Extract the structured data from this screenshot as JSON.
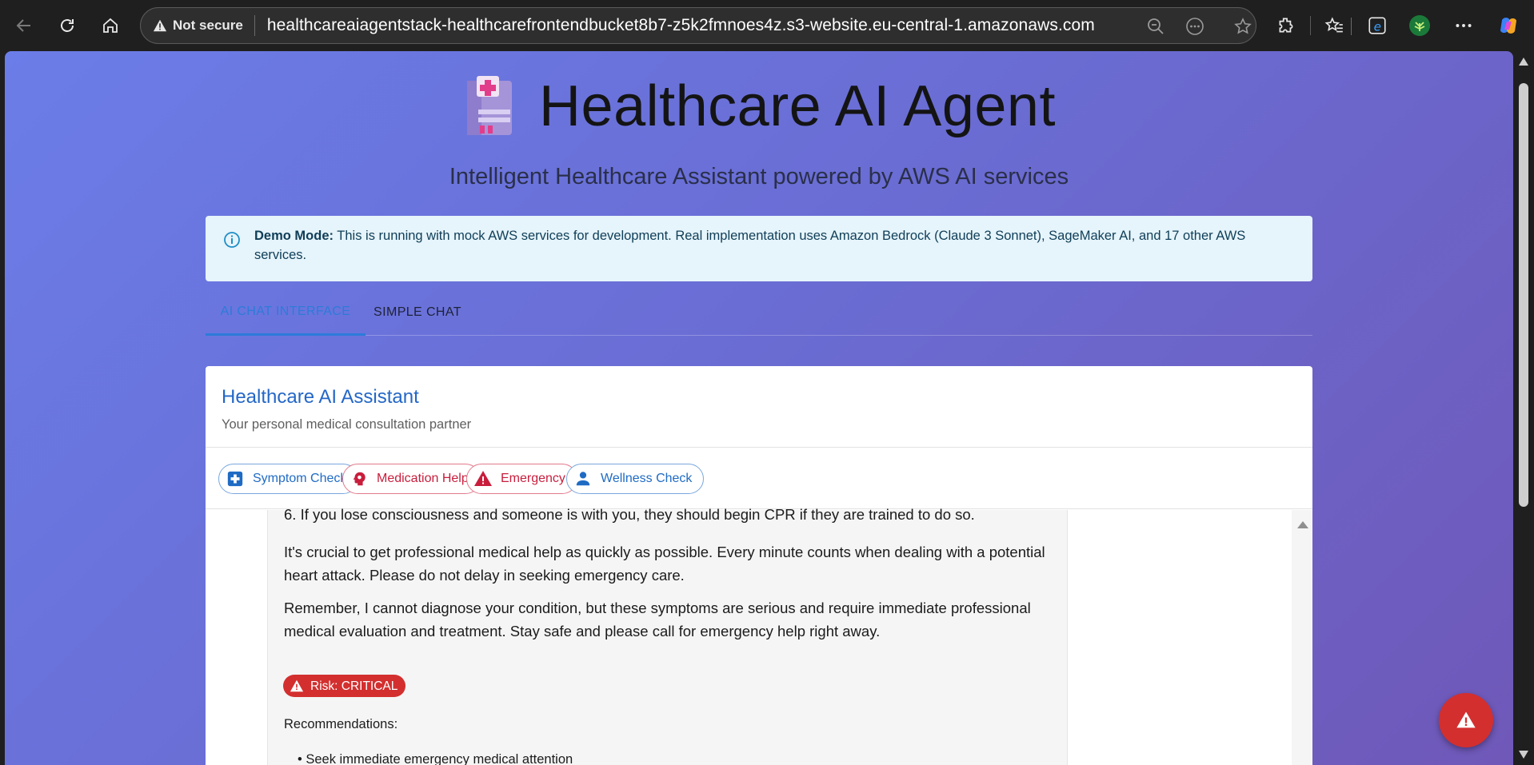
{
  "browser": {
    "security_label": "Not secure",
    "url": "healthcareaiagentstack-healthcarefrontendbucket8b7-z5k2fmnoes4z.s3-website.eu-central-1.amazonaws.com"
  },
  "header": {
    "title": "Healthcare AI Agent",
    "subtitle": "Intelligent Healthcare Assistant powered by AWS AI services"
  },
  "alert": {
    "label": "Demo Mode:",
    "text": " This is running with mock AWS services for development. Real implementation uses Amazon Bedrock (Claude 3 Sonnet), SageMaker AI, and 17 other AWS services."
  },
  "tabs": [
    {
      "label": "AI Chat Interface",
      "active": true
    },
    {
      "label": "Simple Chat",
      "active": false
    }
  ],
  "card": {
    "title": "Healthcare AI Assistant",
    "subtitle": "Your personal medical consultation partner"
  },
  "chips": [
    {
      "label": "Symptom Check",
      "icon": "medical-cross-icon"
    },
    {
      "label": "Medication Help",
      "icon": "psychology-icon"
    },
    {
      "label": "Emergency",
      "icon": "warning-icon"
    },
    {
      "label": "Wellness Check",
      "icon": "person-icon"
    }
  ],
  "message": {
    "line_cpr": "6. If you lose consciousness and someone is with you, they should begin CPR if they are trained to do so.",
    "para_help": "It's crucial to get professional medical help as quickly as possible. Every minute counts when dealing with a potential heart attack. Please do not delay in seeking emergency care.",
    "para_remember": "Remember, I cannot diagnose your condition, but these symptoms are serious and require immediate professional medical evaluation and treatment. Stay safe and please call for emergency help right away.",
    "risk_label": "Risk: CRITICAL",
    "recommendations_label": "Recommendations:",
    "recommendation_1": "• Seek immediate emergency medical attention"
  },
  "colors": {
    "primary": "#2d7bd9",
    "danger": "#d32f2f",
    "alert_bg": "#e6f4fb",
    "gradient_start": "#6b7de8",
    "gradient_end": "#6f58b8"
  }
}
